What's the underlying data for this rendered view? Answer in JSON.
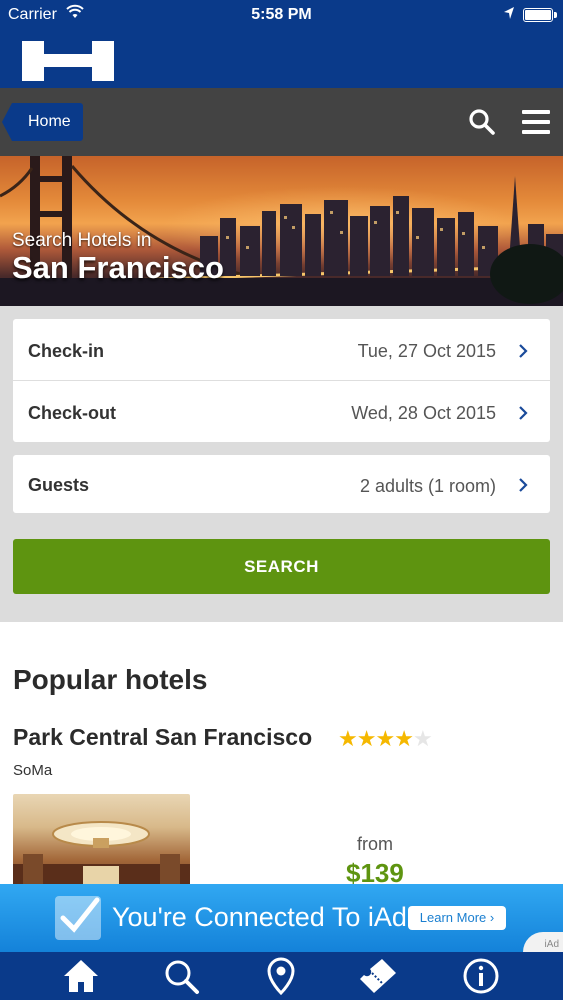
{
  "status_bar": {
    "carrier": "Carrier",
    "time": "5:58 PM"
  },
  "nav": {
    "home_label": "Home",
    "icons": [
      "search-icon",
      "menu-icon"
    ]
  },
  "hero": {
    "subtitle": "Search Hotels in",
    "city": "San Francisco"
  },
  "booking_form": {
    "checkin": {
      "label": "Check-in",
      "value": "Tue, 27 Oct 2015"
    },
    "checkout": {
      "label": "Check-out",
      "value": "Wed, 28 Oct 2015"
    },
    "guests": {
      "label": "Guests",
      "value": "2 adults (1 room)"
    },
    "search_label": "SEARCH"
  },
  "popular": {
    "heading": "Popular hotels",
    "hotels": [
      {
        "name": "Park Central San Francisco",
        "stars": 4,
        "max_stars": 5,
        "area": "SoMa",
        "from_label": "from",
        "price": "$139"
      }
    ]
  },
  "ad": {
    "text": "You're Connected To iAd",
    "button": "Learn More ›",
    "tag": "iAd"
  },
  "tab_bar": {
    "tabs": [
      "home-icon",
      "search-icon",
      "location-pin-icon",
      "ticket-icon",
      "info-icon"
    ]
  },
  "colors": {
    "brand_blue": "#0a3a8a",
    "nav_gray": "#434343",
    "accent_green": "#5e9410",
    "star_gold": "#f5b800"
  }
}
